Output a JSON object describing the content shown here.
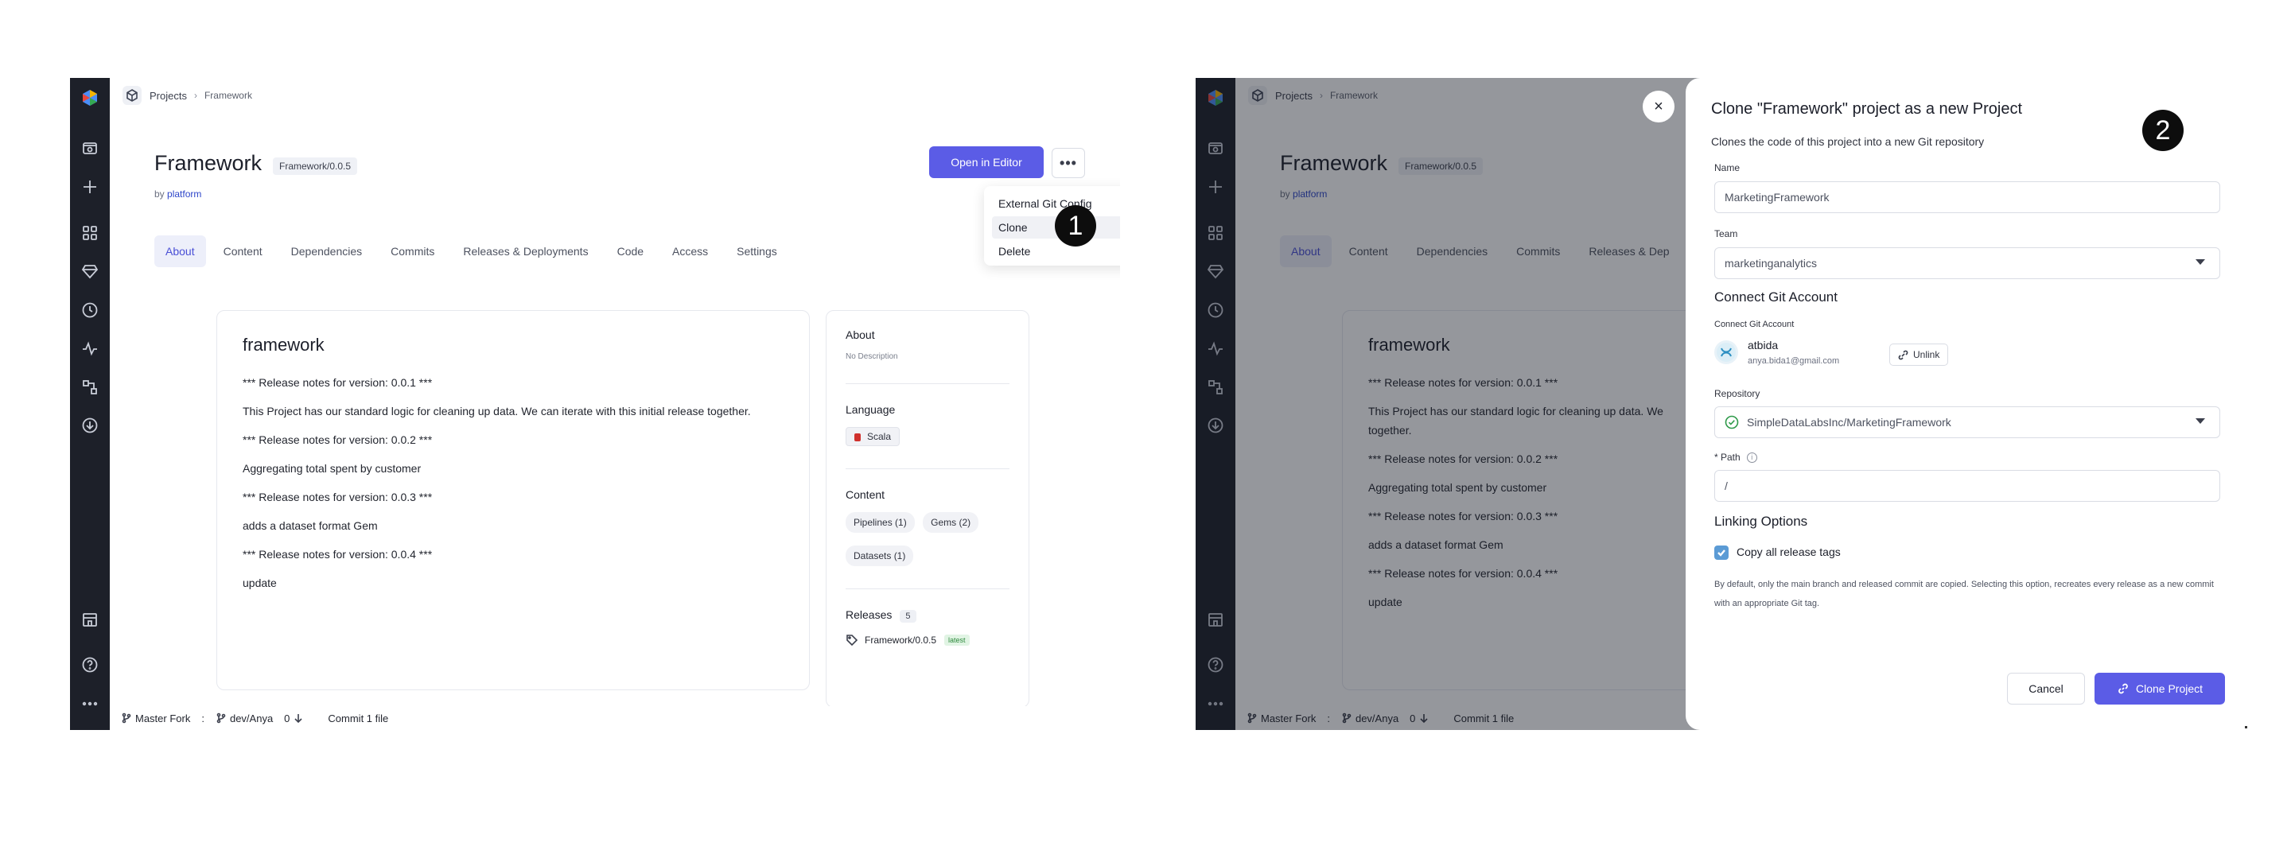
{
  "left": {
    "breadcrumb": {
      "projects": "Projects",
      "sep": "›",
      "current": "Framework"
    },
    "project": {
      "title": "Framework",
      "version": "Framework/0.0.5",
      "by": "by",
      "owner": "platform"
    },
    "actions": {
      "open_editor": "Open in Editor",
      "more": "•••"
    },
    "tabs": [
      "About",
      "Content",
      "Dependencies",
      "Commits",
      "Releases & Deployments",
      "Code",
      "Access",
      "Settings"
    ],
    "menu": {
      "items": [
        "External Git Config",
        "Clone",
        "Delete"
      ]
    },
    "step": "1",
    "readme": {
      "title": "framework",
      "lines": [
        "*** Release notes for version: 0.0.1 ***",
        "This Project has our standard logic for cleaning up data. We can iterate with this initial release together.",
        "*** Release notes for version: 0.0.2 ***",
        "Aggregating total spent by customer",
        "*** Release notes for version: 0.0.3 ***",
        "adds a dataset format Gem",
        "*** Release notes for version: 0.0.4 ***",
        "update"
      ]
    },
    "about": {
      "heading": "About",
      "description": "No Description",
      "language_heading": "Language",
      "language": "Scala",
      "content_heading": "Content",
      "content_chips": [
        "Pipelines (1)",
        "Gems (2)",
        "Datasets (1)"
      ],
      "releases_heading": "Releases",
      "releases_count": "5",
      "release_name": "Framework/0.0.5",
      "latest": "latest"
    },
    "status": {
      "fork": "Master Fork",
      "sep": ":",
      "branch": "dev/Anya",
      "behind": "0",
      "commit": "Commit 1 file"
    }
  },
  "right": {
    "breadcrumb": {
      "projects": "Projects",
      "sep": "›",
      "current": "Framework"
    },
    "project": {
      "title": "Framework",
      "version": "Framework/0.0.5",
      "by": "by",
      "owner": "platform"
    },
    "tabs": [
      "About",
      "Content",
      "Dependencies",
      "Commits",
      "Releases & Dep"
    ],
    "readme": {
      "title": "framework",
      "lines": [
        "*** Release notes for version: 0.0.1 ***",
        "This Project has our standard logic for cleaning up data. We",
        "together.",
        "*** Release notes for version: 0.0.2 ***",
        "Aggregating total spent by customer",
        "*** Release notes for version: 0.0.3 ***",
        "adds a dataset format Gem",
        "*** Release notes for version: 0.0.4 ***",
        "update"
      ]
    },
    "status": {
      "fork": "Master Fork",
      "sep": ":",
      "branch": "dev/Anya",
      "behind": "0",
      "commit": "Commit 1 file"
    },
    "close": "×",
    "step": "2",
    "dialog": {
      "title": "Clone \"Framework\" project as a new Project",
      "subtitle": "Clones the code of this project into a new Git repository",
      "name_label": "Name",
      "name_value": "MarketingFramework",
      "team_label": "Team",
      "team_value": "marketinganalytics",
      "git_heading": "Connect Git Account",
      "git_label": "Connect Git Account",
      "account_name": "atbida",
      "account_email": "anya.bida1@gmail.com",
      "unlink": "Unlink",
      "repo_label": "Repository",
      "repo_value": "SimpleDataLabsInc/MarketingFramework",
      "path_label": "* Path",
      "path_value": "/",
      "linking_heading": "Linking Options",
      "copy_tags": "Copy all release tags",
      "help": "By default, only the main branch and released commit are copied. Selecting this option, recreates every release as a new commit with an appropriate Git tag.",
      "cancel": "Cancel",
      "clone": "Clone Project"
    }
  },
  "colors": {
    "primary": "#5b5ce6",
    "sidebar": "#1d2029",
    "link": "#2d45c9"
  }
}
